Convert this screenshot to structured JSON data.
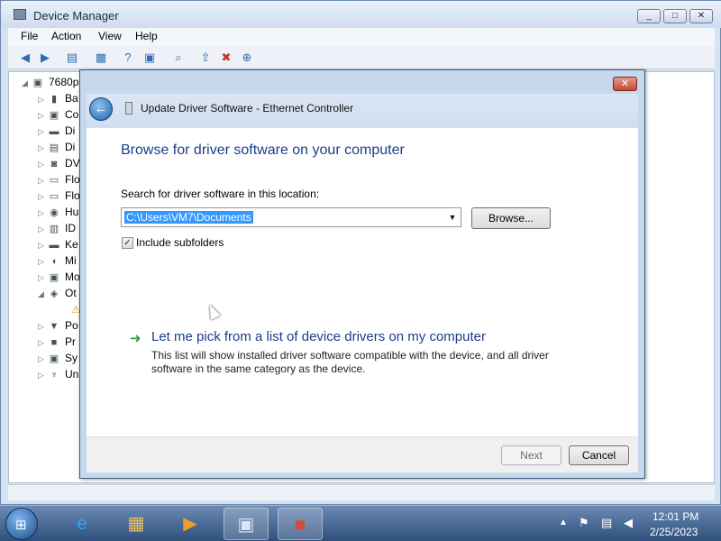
{
  "device_manager": {
    "title": "Device Manager",
    "menu": [
      "File",
      "Action",
      "View",
      "Help"
    ],
    "tree": {
      "root": "7680p",
      "items": [
        "Ba",
        "Co",
        "Di",
        "Di",
        "DV",
        "Flo",
        "Flo",
        "Hu",
        "ID",
        "Ke",
        "Mi",
        "Mo",
        "Ot",
        "Po",
        "Pr",
        "Sy",
        "Un"
      ]
    }
  },
  "dialog": {
    "title": "Update Driver Software - Ethernet Controller",
    "close_glyph": "✕",
    "heading": "Browse for driver software on your computer",
    "search_label": "Search for driver software in this location:",
    "path_value": "C:\\Users\\VM7\\Documents",
    "browse_label": "Browse...",
    "include_subfolders": "Include subfolders",
    "include_subfolders_checked": true,
    "pick_link": "Let me pick from a list of device drivers on my computer",
    "pick_description": "This list will show installed driver software compatible with the device, and all driver software in the same category as the device.",
    "next_label": "Next",
    "cancel_label": "Cancel"
  },
  "taskbar": {
    "apps": [
      "internet-explorer-icon",
      "windows-explorer-icon",
      "media-player-icon",
      "device-manager-icon",
      "toolbox-icon"
    ],
    "time": "12:01 PM",
    "date": "2/25/2023"
  },
  "colors": {
    "heading_blue": "#1b3d8a",
    "selection_blue": "#3399ff",
    "close_red": "#c24a36",
    "link_arrow_green": "#2ea043"
  }
}
